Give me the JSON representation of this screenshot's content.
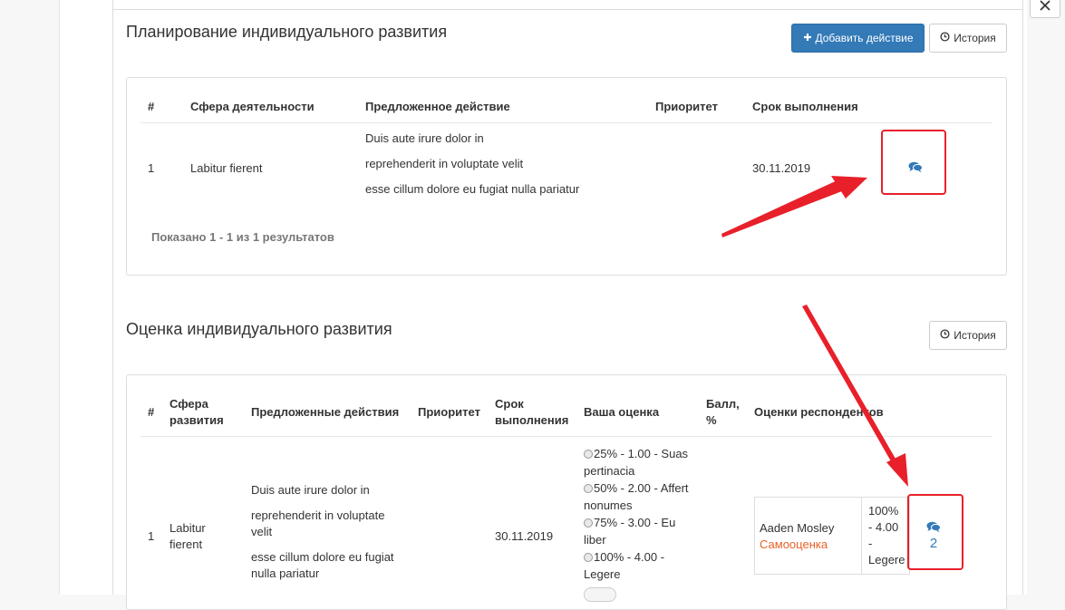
{
  "planning": {
    "title": "Планирование индивидуального развития",
    "add_button": "Добавить действие",
    "history_button": "История",
    "columns": [
      "#",
      "Сфера деятельности",
      "Предложенное действие",
      "Приоритет",
      "Срок выполнения"
    ],
    "rows": [
      {
        "num": "1",
        "sphere": "Labitur fierent",
        "action_lines": [
          "Duis aute irure dolor in",
          "reprehenderit in voluptate velit",
          "esse cillum dolore eu fugiat nulla pariatur"
        ],
        "priority": "",
        "deadline": "30.11.2019",
        "comment_icon": "comments-icon"
      }
    ],
    "summary": {
      "prefix": "Показано ",
      "range": "1 - 1",
      "middle": " из ",
      "total": "1",
      "suffix": " результатов"
    }
  },
  "evaluation": {
    "title": "Оценка индивидуального развития",
    "history_button": "История",
    "columns": {
      "num": "#",
      "sphere_line1": "Сфера",
      "sphere_line2": "развития",
      "actions": "Предложенные действия",
      "priority": "Приоритет",
      "deadline_line1": "Срок",
      "deadline_line2": "выполнения",
      "your_score": "Ваша оценка",
      "score_line1": "Балл,",
      "score_line2": "%",
      "respondents": "Оценки респондентов"
    },
    "row": {
      "num": "1",
      "sphere_line1": "Labitur",
      "sphere_line2": "fierent",
      "action_lines": [
        "Duis aute irure dolor in",
        "reprehenderit in voluptate",
        "velit",
        "esse cillum dolore eu fugiat",
        "nulla pariatur"
      ],
      "deadline": "30.11.2019",
      "options": [
        {
          "line1": "25% - 1.00 - Suas",
          "line2": "pertinacia"
        },
        {
          "line1": "50% - 2.00 - Affert",
          "line2": "nonumes"
        },
        {
          "line1": "75% - 3.00 - Eu",
          "line2": "liber"
        },
        {
          "line1": "100% - 4.00 -",
          "line2": "Legere"
        }
      ],
      "respondent": {
        "name": "Aaden Mosley",
        "role": "Самооценка",
        "score_line1": "100%",
        "score_line2": "- 4.00",
        "score_line3": "-",
        "score_line4": "Legere"
      },
      "comment_count": "2",
      "comment_icon": "comments-icon"
    }
  },
  "colors": {
    "primary": "#337ab7",
    "highlight": "#e8202a",
    "orange_text": "#e8632a"
  }
}
